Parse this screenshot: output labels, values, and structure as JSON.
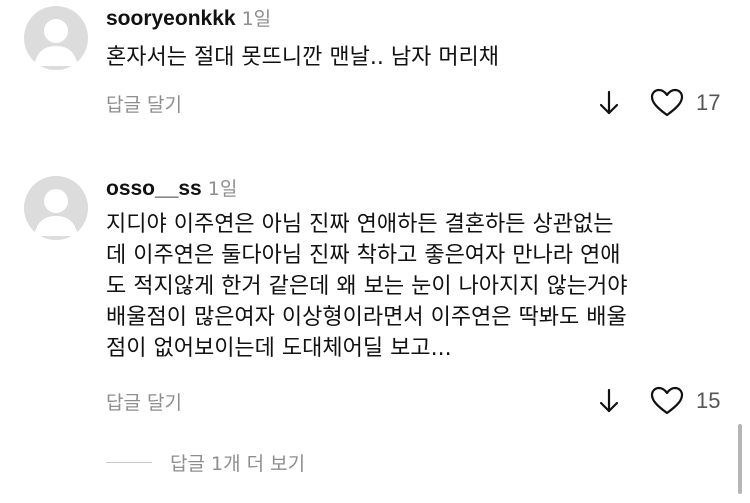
{
  "comments": [
    {
      "username": "sooryeonkkk",
      "time": "1일",
      "text": "혼자서는 절대 못뜨니깐 맨날.. 남자 머리채",
      "reply_label": "답글 달기",
      "likes": "17"
    },
    {
      "username": "osso__ss",
      "time": "1일",
      "text": "지디야 이주연은 아님 진짜 연애하든 결혼하든 상관없는\n데 이주연은 둘다아님 진짜 착하고 좋은여자 만나라 연애\n도 적지않게 한거 같은데 왜 보는 눈이 나아지지 않는거야\n배울점이 많은여자 이상형이라면서 이주연은 딱봐도 배울\n점이 없어보이는데 도대체어딜 보고...",
      "reply_label": "답글 달기",
      "likes": "15"
    }
  ],
  "view_replies_label": "답글 1개 더 보기",
  "icons": {
    "avatar": "default-user-avatar",
    "download": "down-arrow-icon",
    "like": "heart-outline-icon"
  },
  "colors": {
    "text": "#111111",
    "muted": "#8e8e8e",
    "avatar_bg": "#dcdcdc",
    "avatar_fg": "#ffffff"
  }
}
